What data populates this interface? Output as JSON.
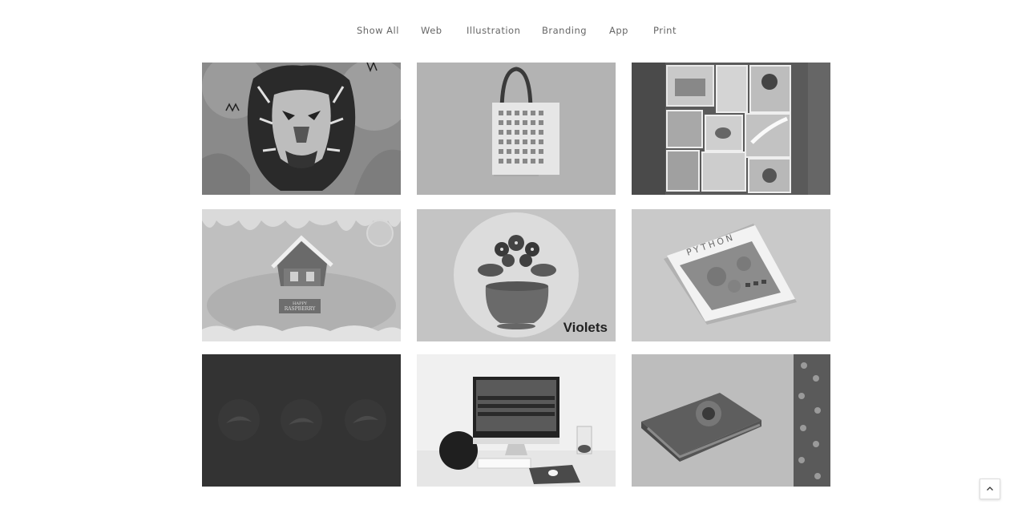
{
  "filters": [
    "Show All",
    "Web",
    "Illustration",
    "Branding",
    "App",
    "Print"
  ],
  "portfolio": {
    "items": [
      {
        "name": "lion-illustration"
      },
      {
        "name": "shopping-bag-mockup"
      },
      {
        "name": "postage-stamps"
      },
      {
        "name": "gingerbread-house",
        "sign_line1": "HAPPY",
        "sign_line2": "RASPBERRY"
      },
      {
        "name": "violets-illustration",
        "caption": "Violets"
      },
      {
        "name": "python-booklet",
        "cover_title": "PYTHON"
      },
      {
        "name": "dark-web-birds"
      },
      {
        "name": "imac-website-mockup"
      },
      {
        "name": "floral-box-packaging"
      }
    ]
  },
  "icons": {
    "scroll_top": "chevron-up-icon"
  }
}
